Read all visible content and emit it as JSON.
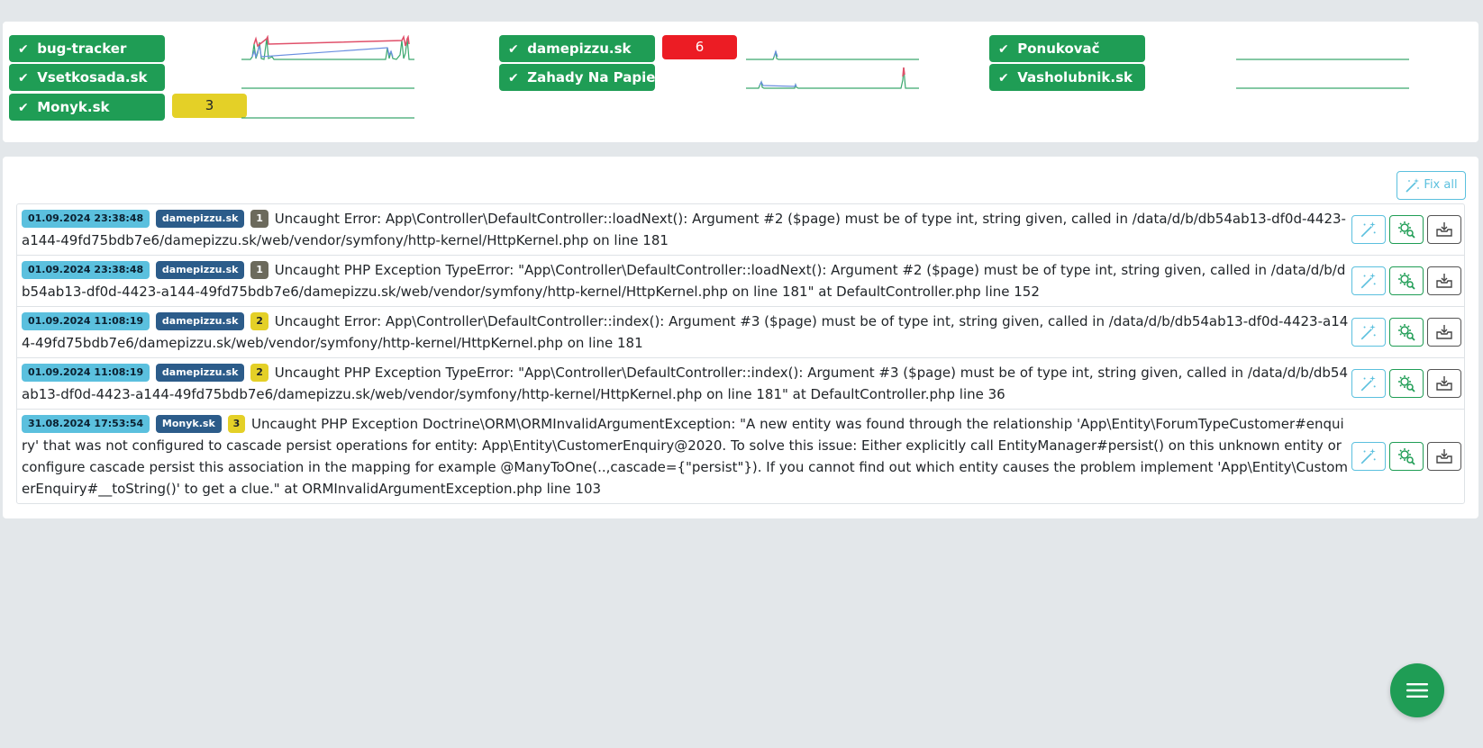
{
  "colors": {
    "success": "#1f9d55",
    "danger": "#ec1c24",
    "warning": "#e4d027",
    "info": "#5bc0de",
    "project_badge": "#2c5c8a",
    "spark_line": "#3aa76d",
    "spark_peak_red": "#e0506a",
    "spark_peak_blue": "#6a8fe0"
  },
  "projects": [
    {
      "name": "bug-tracker",
      "icon": "check-icon",
      "count": ""
    },
    {
      "name": "damepizzu.sk",
      "icon": "check-icon",
      "count": "6"
    },
    {
      "name": "Ponukovač",
      "icon": "check-icon",
      "count": ""
    },
    {
      "name": "Vsetkosada.sk",
      "icon": "check-icon",
      "count": ""
    },
    {
      "name": "Zahady Na Papieri",
      "icon": "check-icon",
      "count": ""
    },
    {
      "name": "Vasholubnik.sk",
      "icon": "check-icon",
      "count": ""
    },
    {
      "name": "Monyk.sk",
      "icon": "check-icon",
      "count": "3"
    }
  ],
  "fix_all_label": "Fix all",
  "errors": [
    {
      "date": "01.09.2024 23:38:48",
      "project": "damepizzu.sk",
      "count": "1",
      "message": "Uncaught Error: App\\Controller\\DefaultController::loadNext(): Argument #2 ($page) must be of type int, string given, called in /data/d/b/db54ab13-df0d-4423-a144-49fd75bdb7e6/damepizzu.sk/web/vendor/symfony/http-kernel/HttpKernel.php on line 181"
    },
    {
      "date": "01.09.2024 23:38:48",
      "project": "damepizzu.sk",
      "count": "1",
      "message": "Uncaught PHP Exception TypeError: \"App\\Controller\\DefaultController::loadNext(): Argument #2 ($page) must be of type int, string given, called in /data/d/b/db54ab13-df0d-4423-a144-49fd75bdb7e6/damepizzu.sk/web/vendor/symfony/http-kernel/HttpKernel.php on line 181\" at DefaultController.php line 152"
    },
    {
      "date": "01.09.2024 11:08:19",
      "project": "damepizzu.sk",
      "count": "2",
      "message": "Uncaught Error: App\\Controller\\DefaultController::index(): Argument #3 ($page) must be of type int, string given, called in /data/d/b/db54ab13-df0d-4423-a144-49fd75bdb7e6/damepizzu.sk/web/vendor/symfony/http-kernel/HttpKernel.php on line 181"
    },
    {
      "date": "01.09.2024 11:08:19",
      "project": "damepizzu.sk",
      "count": "2",
      "message": "Uncaught PHP Exception TypeError: \"App\\Controller\\DefaultController::index(): Argument #3 ($page) must be of type int, string given, called in /data/d/b/db54ab13-df0d-4423-a144-49fd75bdb7e6/damepizzu.sk/web/vendor/symfony/http-kernel/HttpKernel.php on line 181\" at DefaultController.php line 36"
    },
    {
      "date": "31.08.2024 17:53:54",
      "project": "Monyk.sk",
      "count": "3",
      "message": "Uncaught PHP Exception Doctrine\\ORM\\ORMInvalidArgumentException: \"A new entity was found through the relationship 'App\\Entity\\ForumTypeCustomer#enquiry' that was not configured to cascade persist operations for entity: App\\Entity\\CustomerEnquiry@2020. To solve this issue: Either explicitly call EntityManager#persist() on this unknown entity or configure cascade persist this association in the mapping for example @ManyToOne(..,cascade={\"persist\"}). If you cannot find out which entity causes the problem implement 'App\\Entity\\CustomerEnquiry#__toString()' to get a clue.\" at ORMInvalidArgumentException.php line 103"
    }
  ],
  "row_actions": {
    "fix": "magic-wand-icon",
    "inspect": "gear-search-icon",
    "archive": "archive-box-icon"
  },
  "fab_icon": "menu-icon"
}
